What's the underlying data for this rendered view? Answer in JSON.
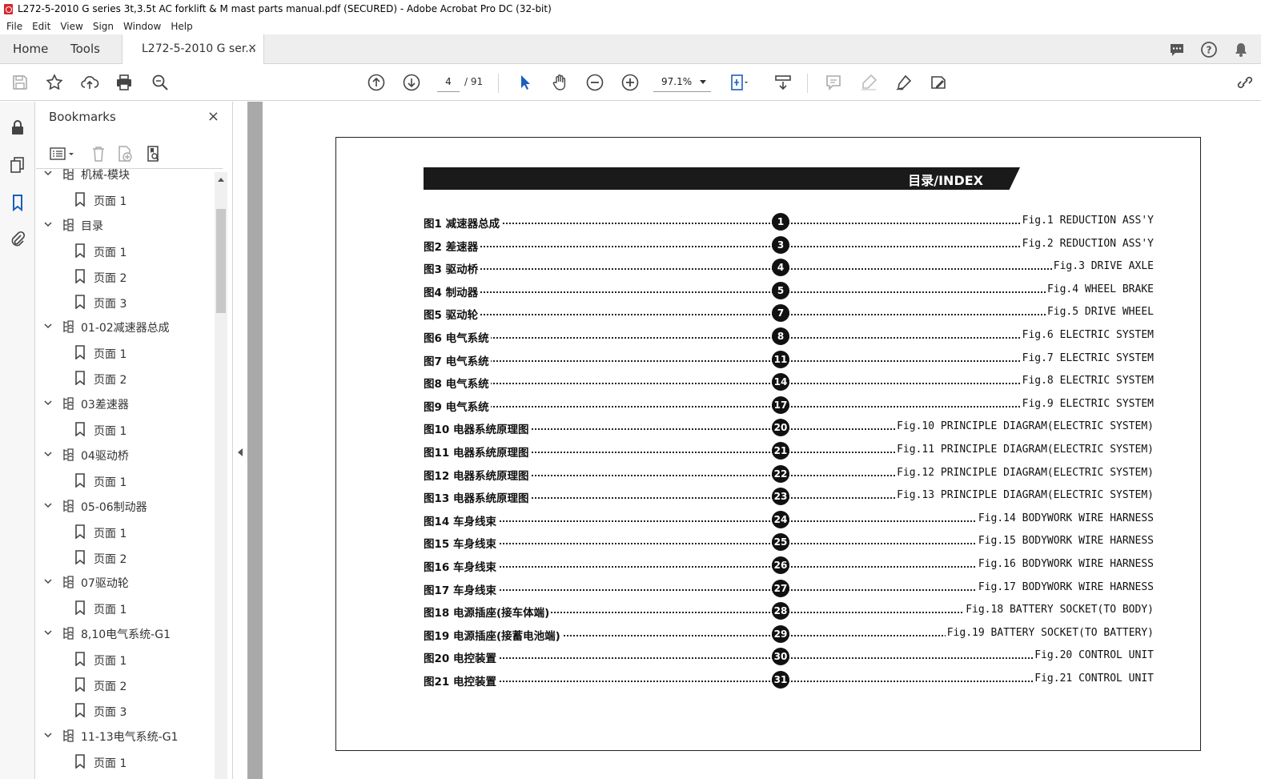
{
  "window": {
    "title": "L272-5-2010 G series 3t,3.5t AC forklift & M mast parts manual.pdf (SECURED) - Adobe Acrobat Pro DC (32-bit)"
  },
  "menu": [
    "File",
    "Edit",
    "View",
    "Sign",
    "Window",
    "Help"
  ],
  "tabs": {
    "home": "Home",
    "tools": "Tools",
    "doc": "L272-5-2010 G ser...",
    "close": "×"
  },
  "toolbar": {
    "page_current": "4",
    "page_total": "/ 91",
    "zoom": "97.1%"
  },
  "bookmarks": {
    "title": "Bookmarks",
    "close": "×",
    "items": [
      {
        "type": "parent",
        "label": "机械-模块"
      },
      {
        "type": "child",
        "label": "页面 1"
      },
      {
        "type": "parent",
        "label": "目录"
      },
      {
        "type": "child",
        "label": "页面 1"
      },
      {
        "type": "child",
        "label": "页面 2"
      },
      {
        "type": "child",
        "label": "页面 3"
      },
      {
        "type": "parent",
        "label": "01-02减速器总成"
      },
      {
        "type": "child",
        "label": "页面 1"
      },
      {
        "type": "child",
        "label": "页面 2"
      },
      {
        "type": "parent",
        "label": "03差速器"
      },
      {
        "type": "child",
        "label": "页面 1"
      },
      {
        "type": "parent",
        "label": "04驱动桥"
      },
      {
        "type": "child",
        "label": "页面 1"
      },
      {
        "type": "parent",
        "label": "05-06制动器"
      },
      {
        "type": "child",
        "label": "页面 1"
      },
      {
        "type": "child",
        "label": "页面 2"
      },
      {
        "type": "parent",
        "label": "07驱动轮"
      },
      {
        "type": "child",
        "label": "页面 1"
      },
      {
        "type": "parent",
        "label": "8,10电气系统-G1"
      },
      {
        "type": "child",
        "label": "页面 1"
      },
      {
        "type": "child",
        "label": "页面 2"
      },
      {
        "type": "child",
        "label": "页面 3"
      },
      {
        "type": "parent",
        "label": "11-13电气系统-G1"
      },
      {
        "type": "child",
        "label": "页面 1"
      }
    ]
  },
  "document": {
    "banner": "目录/INDEX",
    "entries": [
      {
        "cn": "图1 减速器总成",
        "num": "1",
        "en": "Fig.1 REDUCTION ASS'Y"
      },
      {
        "cn": "图2 差速器",
        "num": "3",
        "en": "Fig.2 REDUCTION ASS'Y"
      },
      {
        "cn": "图3 驱动桥",
        "num": "4",
        "en": "Fig.3 DRIVE AXLE"
      },
      {
        "cn": "图4 制动器",
        "num": "5",
        "en": "Fig.4 WHEEL BRAKE"
      },
      {
        "cn": "图5 驱动轮",
        "num": "7",
        "en": "Fig.5 DRIVE WHEEL"
      },
      {
        "cn": "图6 电气系统",
        "num": "8",
        "en": "Fig.6 ELECTRIC SYSTEM"
      },
      {
        "cn": "图7 电气系统",
        "num": "11",
        "en": "Fig.7 ELECTRIC SYSTEM"
      },
      {
        "cn": "图8 电气系统",
        "num": "14",
        "en": "Fig.8 ELECTRIC SYSTEM"
      },
      {
        "cn": "图9 电气系统",
        "num": "17",
        "en": "Fig.9 ELECTRIC SYSTEM"
      },
      {
        "cn": "图10 电器系统原理图",
        "num": "20",
        "en": "Fig.10 PRINCIPLE DIAGRAM(ELECTRIC SYSTEM)"
      },
      {
        "cn": "图11 电器系统原理图",
        "num": "21",
        "en": "Fig.11 PRINCIPLE DIAGRAM(ELECTRIC SYSTEM)"
      },
      {
        "cn": "图12 电器系统原理图",
        "num": "22",
        "en": "Fig.12 PRINCIPLE DIAGRAM(ELECTRIC SYSTEM)"
      },
      {
        "cn": "图13 电器系统原理图",
        "num": "23",
        "en": "Fig.13 PRINCIPLE DIAGRAM(ELECTRIC SYSTEM)"
      },
      {
        "cn": "图14 车身线束",
        "num": "24",
        "en": "Fig.14 BODYWORK WIRE HARNESS"
      },
      {
        "cn": "图15 车身线束",
        "num": "25",
        "en": "Fig.15 BODYWORK WIRE HARNESS"
      },
      {
        "cn": "图16 车身线束",
        "num": "26",
        "en": "Fig.16 BODYWORK WIRE HARNESS"
      },
      {
        "cn": "图17 车身线束",
        "num": "27",
        "en": "Fig.17 BODYWORK WIRE HARNESS"
      },
      {
        "cn": "图18 电源插座(接车体端)",
        "num": "28",
        "en": "Fig.18 BATTERY SOCKET(TO BODY)"
      },
      {
        "cn": "图19 电源插座(接蓄电池端)",
        "num": "29",
        "en": "Fig.19 BATTERY SOCKET(TO BATTERY)"
      },
      {
        "cn": "图20 电控装置",
        "num": "30",
        "en": "Fig.20 CONTROL UNIT"
      },
      {
        "cn": "图21 电控装置",
        "num": "31",
        "en": "Fig.21 CONTROL UNIT"
      }
    ]
  }
}
